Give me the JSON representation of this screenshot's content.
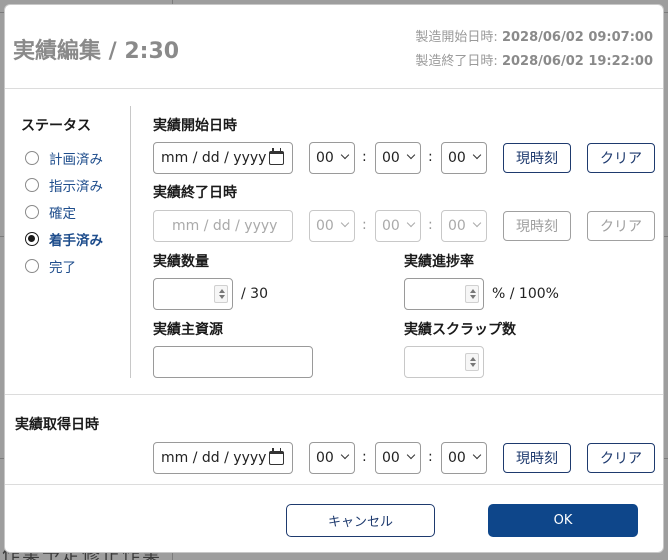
{
  "background": {
    "footer_text": "作業予定修正作業"
  },
  "header": {
    "title": "実績編集 / 2:30",
    "mfg_start_label": "製造開始日時: ",
    "mfg_start_value": "2028/06/02 09:07:00",
    "mfg_end_label": "製造終了日時: ",
    "mfg_end_value": "2028/06/02 19:22:00"
  },
  "status": {
    "title": "ステータス",
    "options": [
      {
        "label": "計画済み",
        "selected": false
      },
      {
        "label": "指示済み",
        "selected": false
      },
      {
        "label": "確定",
        "selected": false
      },
      {
        "label": "着手済み",
        "selected": true
      },
      {
        "label": "完了",
        "selected": false
      }
    ]
  },
  "actual_start": {
    "label": "実績開始日時",
    "date_placeholder": "mm / dd / yyyy",
    "hour": "00",
    "minute": "00",
    "second": "00",
    "now_label": "現時刻",
    "clear_label": "クリア"
  },
  "actual_end": {
    "label": "実績終了日時",
    "date_placeholder": "mm / dd / yyyy",
    "hour": "00",
    "minute": "00",
    "second": "00",
    "now_label": "現時刻",
    "clear_label": "クリア"
  },
  "quantity": {
    "label": "実績数量",
    "value": "",
    "total": "/  30"
  },
  "progress": {
    "label": "実績進捗率",
    "value": "",
    "suffix": "% / 100%"
  },
  "main_resource": {
    "label": "実績主資源",
    "value": ""
  },
  "scrap": {
    "label": "実績スクラップ数",
    "value": ""
  },
  "acquired": {
    "label": "実績取得日時",
    "date_placeholder": "mm / dd / yyyy",
    "hour": "00",
    "minute": "00",
    "second": "00",
    "now_label": "現時刻",
    "clear_label": "クリア"
  },
  "footer": {
    "cancel_label": "キャンセル",
    "ok_label": "OK"
  },
  "colors": {
    "primary": "#0e468a",
    "outline": "#1e3a6e",
    "status_text": "#1e4d8c"
  }
}
